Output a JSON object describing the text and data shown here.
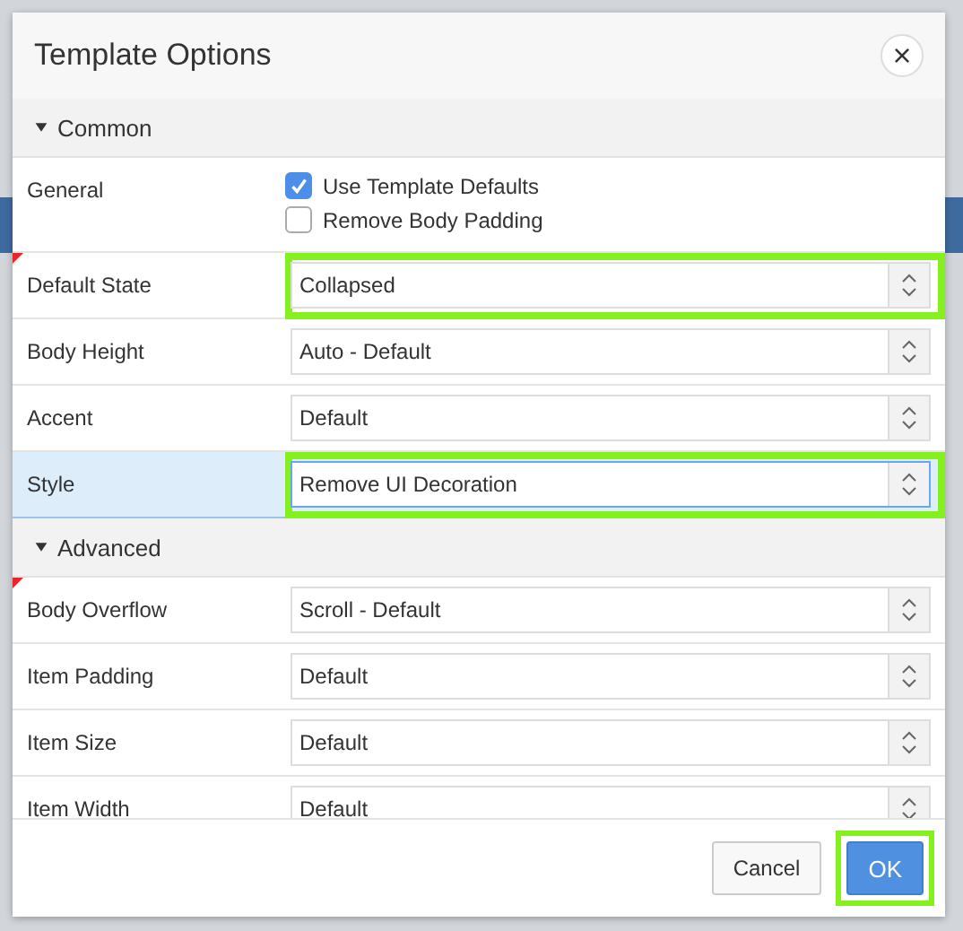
{
  "dialog": {
    "title": "Template Options",
    "close_icon": "×"
  },
  "sections": [
    {
      "title": "Common",
      "expanded": true,
      "rows": [
        {
          "kind": "checkboxes",
          "label": "General",
          "changed": false,
          "selected": false,
          "options": [
            {
              "label": "Use Template Defaults",
              "checked": true
            },
            {
              "label": "Remove Body Padding",
              "checked": false
            }
          ]
        },
        {
          "kind": "select",
          "label": "Default State",
          "value": "Collapsed",
          "changed": true,
          "selected": false,
          "highlighted": true
        },
        {
          "kind": "select",
          "label": "Body Height",
          "value": "Auto - Default",
          "changed": false,
          "selected": false,
          "highlighted": false
        },
        {
          "kind": "select",
          "label": "Accent",
          "value": "Default",
          "changed": false,
          "selected": false,
          "highlighted": false
        },
        {
          "kind": "select",
          "label": "Style",
          "value": "Remove UI Decoration",
          "changed": false,
          "selected": true,
          "highlighted": true
        }
      ]
    },
    {
      "title": "Advanced",
      "expanded": true,
      "rows": [
        {
          "kind": "select",
          "label": "Body Overflow",
          "value": "Scroll - Default",
          "changed": true,
          "selected": false,
          "highlighted": false
        },
        {
          "kind": "select",
          "label": "Item Padding",
          "value": "Default",
          "changed": false,
          "selected": false,
          "highlighted": false
        },
        {
          "kind": "select",
          "label": "Item Size",
          "value": "Default",
          "changed": false,
          "selected": false,
          "highlighted": false
        },
        {
          "kind": "select",
          "label": "Item Width",
          "value": "Default",
          "changed": false,
          "selected": false,
          "highlighted": false
        }
      ]
    }
  ],
  "buttons": [
    {
      "label": "Cancel",
      "primary": false,
      "highlighted": false
    },
    {
      "label": "OK",
      "primary": true,
      "highlighted": true
    }
  ]
}
